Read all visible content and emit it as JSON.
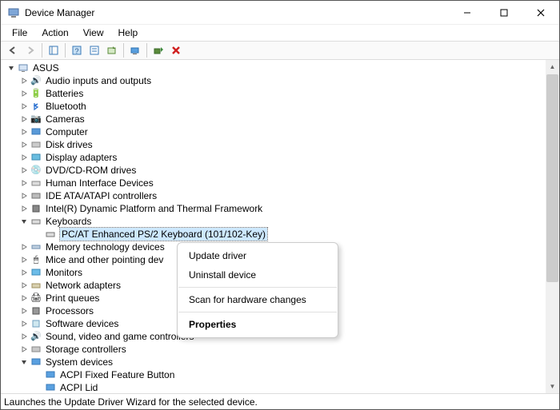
{
  "window": {
    "title": "Device Manager"
  },
  "menu": {
    "file": "File",
    "action": "Action",
    "view": "View",
    "help": "Help"
  },
  "tree": {
    "root": "ASUS",
    "n_audio": "Audio inputs and outputs",
    "n_batteries": "Batteries",
    "n_bluetooth": "Bluetooth",
    "n_cameras": "Cameras",
    "n_computer": "Computer",
    "n_disk": "Disk drives",
    "n_display": "Display adapters",
    "n_dvd": "DVD/CD-ROM drives",
    "n_hid": "Human Interface Devices",
    "n_ide": "IDE ATA/ATAPI controllers",
    "n_intel": "Intel(R) Dynamic Platform and Thermal Framework",
    "n_keyboards": "Keyboards",
    "n_kbd_sel": "PC/AT Enhanced PS/2 Keyboard (101/102-Key)",
    "n_memtech": "Memory technology devices",
    "n_mice": "Mice and other pointing dev",
    "n_monitors": "Monitors",
    "n_network": "Network adapters",
    "n_printq": "Print queues",
    "n_proc": "Processors",
    "n_software": "Software devices",
    "n_sound": "Sound, video and game controllers",
    "n_storage": "Storage controllers",
    "n_system": "System devices",
    "n_acpi_btn": "ACPI Fixed Feature Button",
    "n_acpi_lid": "ACPI Lid"
  },
  "ctx": {
    "update": "Update driver",
    "uninstall": "Uninstall device",
    "scan": "Scan for hardware changes",
    "props": "Properties"
  },
  "status": "Launches the Update Driver Wizard for the selected device."
}
